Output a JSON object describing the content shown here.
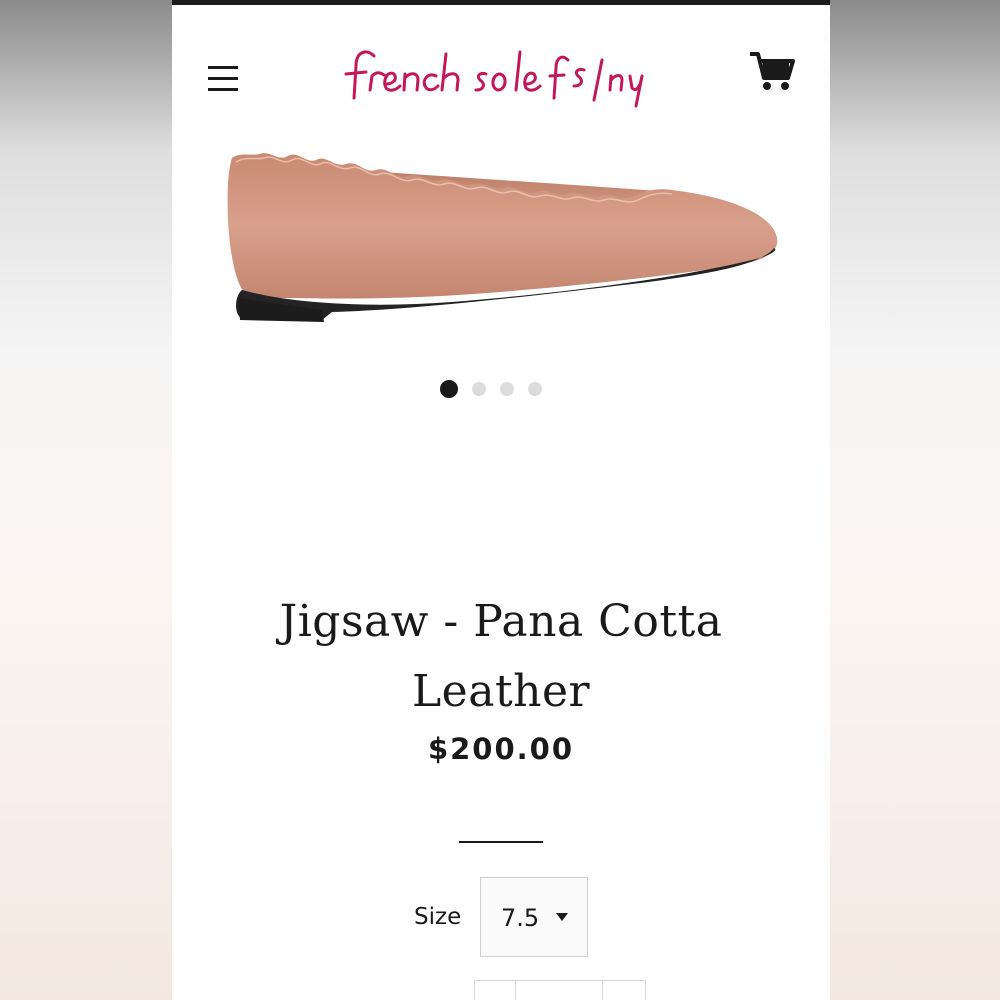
{
  "header": {
    "logo_text": "french sole fs/ny",
    "brand_color": "#c2185b",
    "menu_icon": "hamburger-menu-icon",
    "cart_icon": "shopping-cart-icon"
  },
  "gallery": {
    "image_alt": "Jigsaw scalloped ballet flat in Pana Cotta leather",
    "slide_count": 4,
    "active_slide": 1
  },
  "product": {
    "title": "Jigsaw - Pana Cotta Leather",
    "price": "$200.00"
  },
  "options": {
    "size_label": "Size",
    "size_value": "7.5"
  },
  "colors": {
    "shoe": "#d49a83",
    "text": "#1a1a1a"
  }
}
